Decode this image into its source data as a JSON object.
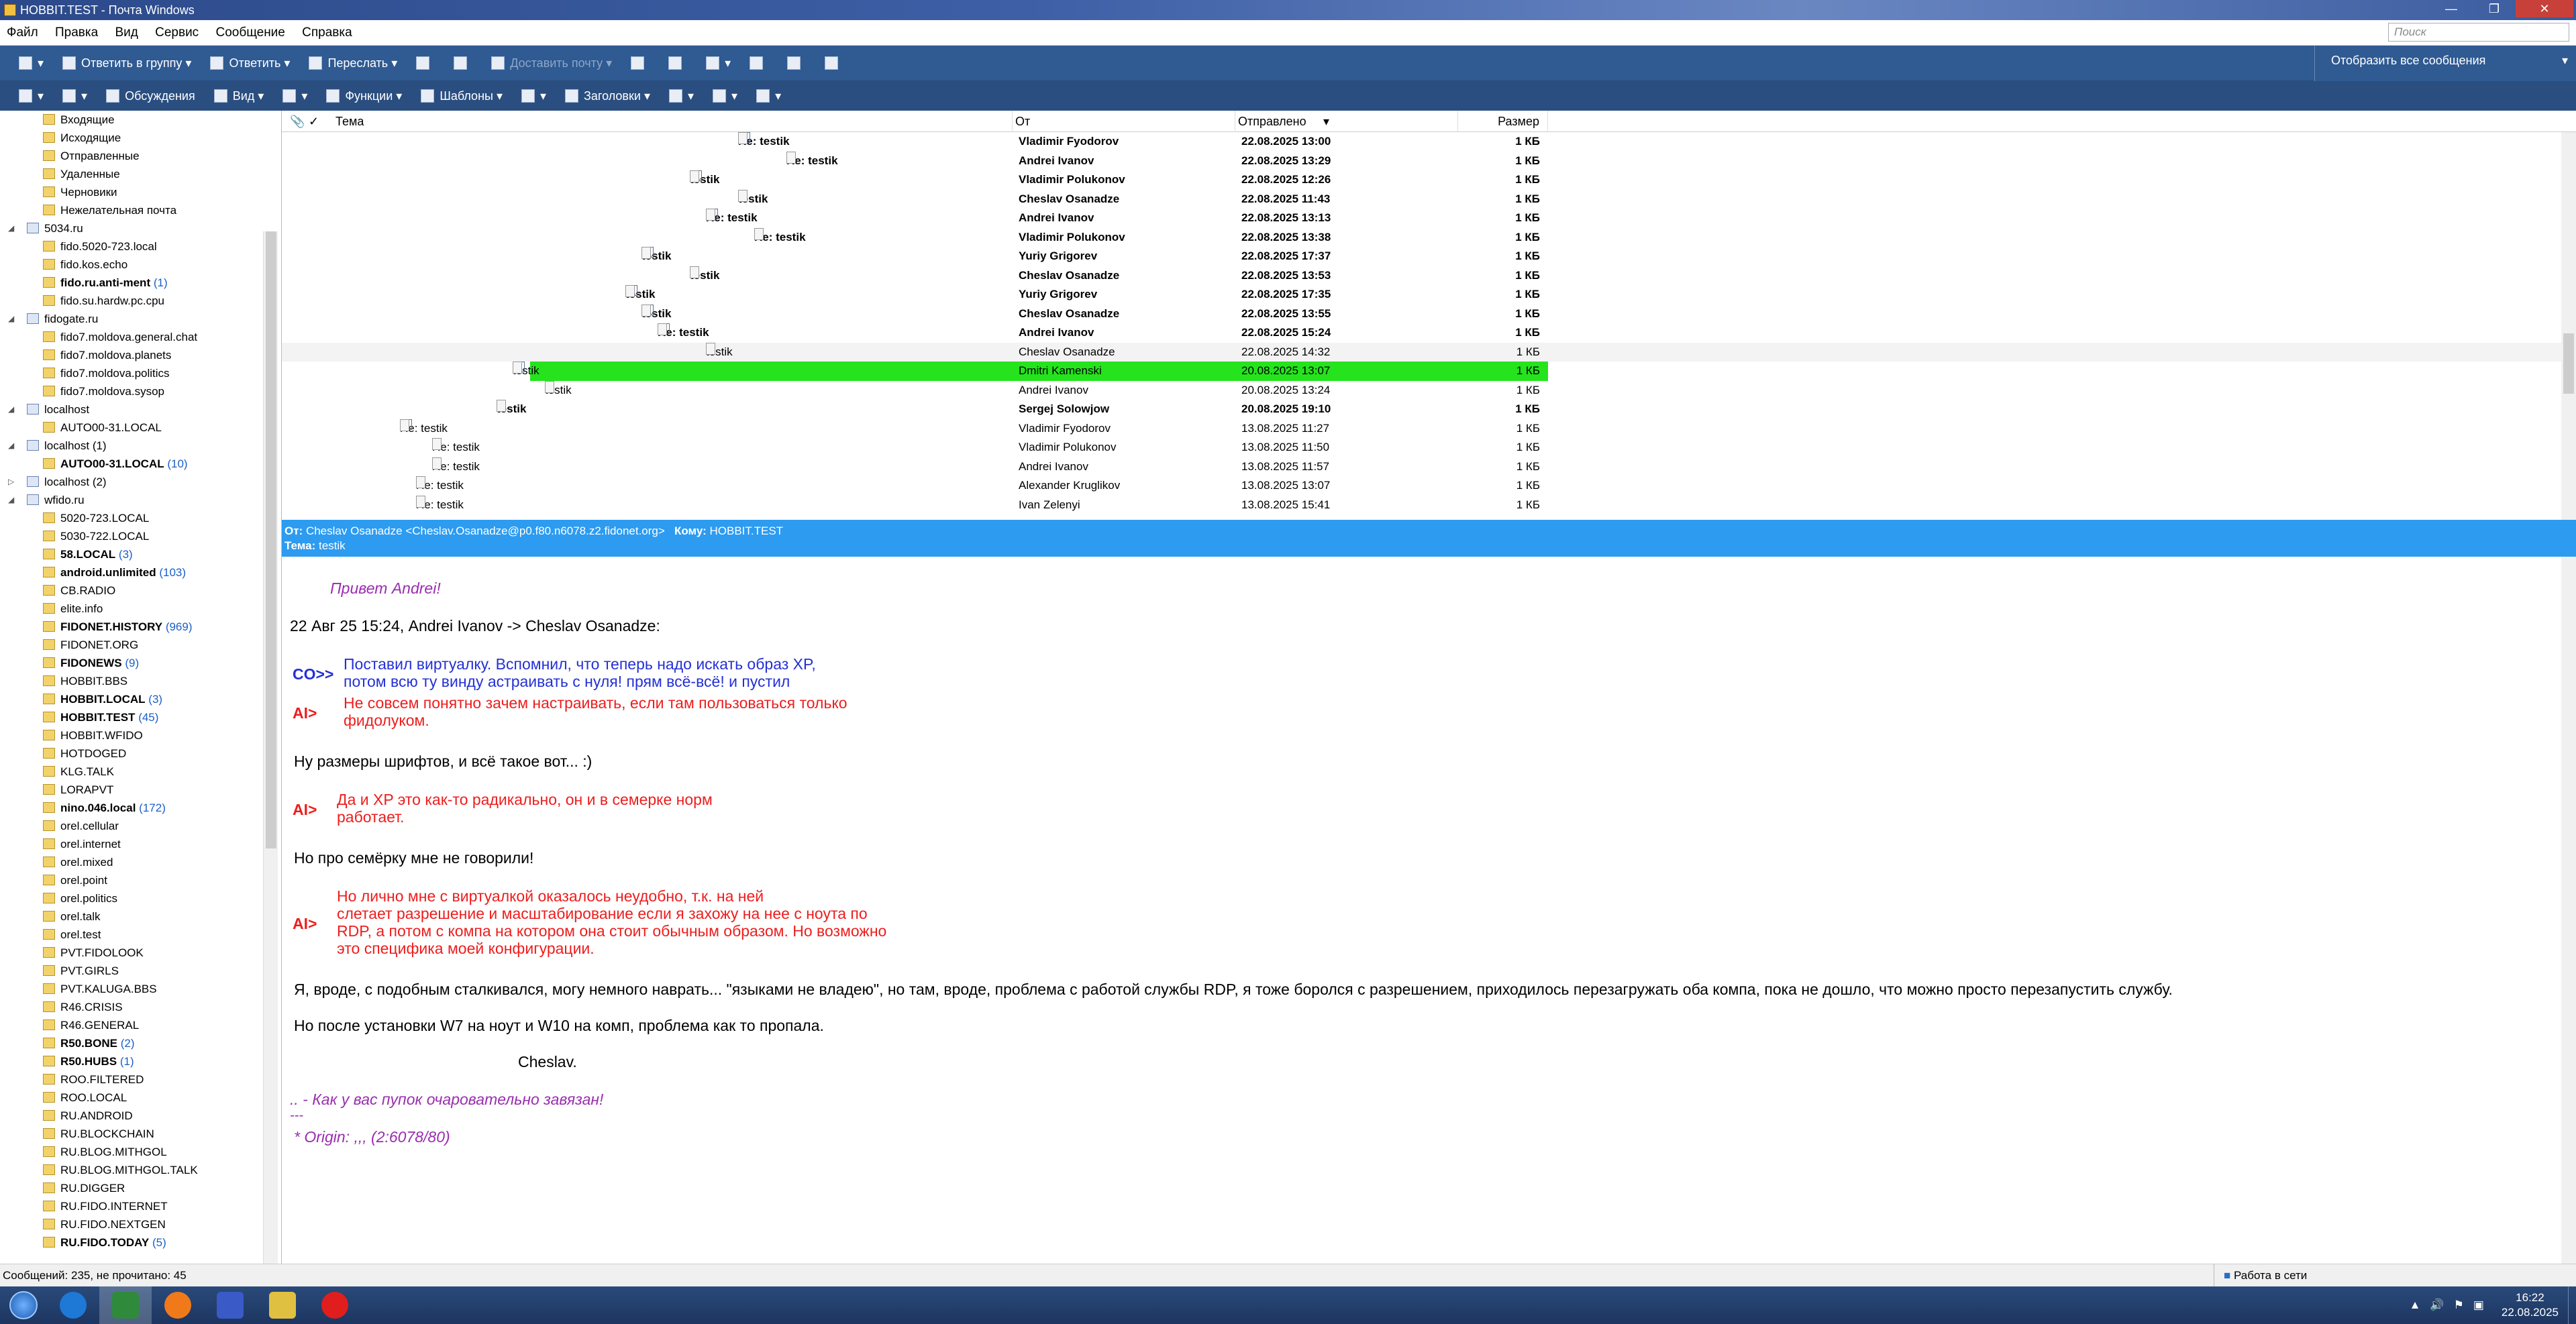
{
  "window": {
    "title": "HOBBIT.TEST - Почта Windows"
  },
  "menu": [
    "Файл",
    "Правка",
    "Вид",
    "Сервис",
    "Сообщение",
    "Справка"
  ],
  "search_placeholder": "Поиск",
  "toolbar1": {
    "reply_group": "Ответить в группу",
    "reply": "Ответить",
    "forward": "Переслать",
    "deliver": "Доставить почту"
  },
  "toolbar2": {
    "discussions": "Обсуждения",
    "view": "Вид",
    "functions": "Функции",
    "templates": "Шаблоны",
    "headers": "Заголовки"
  },
  "filter": "Отобразить все сообщения",
  "folders": [
    {
      "name": "Входящие",
      "level": 2
    },
    {
      "name": "Исходящие",
      "level": 2
    },
    {
      "name": "Отправленные",
      "level": 2
    },
    {
      "name": "Удаленные",
      "level": 2
    },
    {
      "name": "Черновики",
      "level": 2
    },
    {
      "name": "Нежелательная почта",
      "level": 2
    },
    {
      "name": "5034.ru",
      "level": 1,
      "expanded": true
    },
    {
      "name": "fido.5020-723.local",
      "level": 2
    },
    {
      "name": "fido.kos.echo",
      "level": 2
    },
    {
      "name": "fido.ru.anti-ment",
      "count": "(1)",
      "bold": true,
      "level": 2
    },
    {
      "name": "fido.su.hardw.pc.cpu",
      "level": 2
    },
    {
      "name": "fidogate.ru",
      "level": 1,
      "expanded": true
    },
    {
      "name": "fido7.moldova.general.chat",
      "level": 2
    },
    {
      "name": "fido7.moldova.planets",
      "level": 2
    },
    {
      "name": "fido7.moldova.politics",
      "level": 2
    },
    {
      "name": "fido7.moldova.sysop",
      "level": 2
    },
    {
      "name": "localhost",
      "level": 1,
      "expanded": true
    },
    {
      "name": "AUTO00-31.LOCAL",
      "level": 2
    },
    {
      "name": "localhost (1)",
      "level": 1,
      "expanded": true
    },
    {
      "name": "AUTO00-31.LOCAL",
      "count": "(10)",
      "bold": true,
      "level": 2
    },
    {
      "name": "localhost (2)",
      "level": 1,
      "expanded": false
    },
    {
      "name": "wfido.ru",
      "level": 1,
      "expanded": true
    },
    {
      "name": "5020-723.LOCAL",
      "level": 2
    },
    {
      "name": "5030-722.LOCAL",
      "level": 2
    },
    {
      "name": "58.LOCAL",
      "count": "(3)",
      "bold": true,
      "level": 2
    },
    {
      "name": "android.unlimited",
      "count": "(103)",
      "bold": true,
      "level": 2
    },
    {
      "name": "CB.RADIO",
      "level": 2
    },
    {
      "name": "elite.info",
      "level": 2
    },
    {
      "name": "FIDONET.HISTORY",
      "count": "(969)",
      "bold": true,
      "level": 2
    },
    {
      "name": "FIDONET.ORG",
      "level": 2
    },
    {
      "name": "FIDONEWS",
      "count": "(9)",
      "bold": true,
      "level": 2
    },
    {
      "name": "HOBBIT.BBS",
      "level": 2
    },
    {
      "name": "HOBBIT.LOCAL",
      "count": "(3)",
      "bold": true,
      "level": 2
    },
    {
      "name": "HOBBIT.TEST",
      "count": "(45)",
      "bold": true,
      "level": 2
    },
    {
      "name": "HOBBIT.WFIDO",
      "level": 2
    },
    {
      "name": "HOTDOGED",
      "level": 2
    },
    {
      "name": "KLG.TALK",
      "level": 2
    },
    {
      "name": "LORAPVT",
      "level": 2
    },
    {
      "name": "nino.046.local",
      "count": "(172)",
      "bold": true,
      "level": 2
    },
    {
      "name": "orel.cellular",
      "level": 2
    },
    {
      "name": "orel.internet",
      "level": 2
    },
    {
      "name": "orel.mixed",
      "level": 2
    },
    {
      "name": "orel.point",
      "level": 2
    },
    {
      "name": "orel.politics",
      "level": 2
    },
    {
      "name": "orel.talk",
      "level": 2
    },
    {
      "name": "orel.test",
      "level": 2
    },
    {
      "name": "PVT.FIDOLOOK",
      "level": 2
    },
    {
      "name": "PVT.GIRLS",
      "level": 2
    },
    {
      "name": "PVT.KALUGA.BBS",
      "level": 2
    },
    {
      "name": "R46.CRISIS",
      "level": 2
    },
    {
      "name": "R46.GENERAL",
      "level": 2
    },
    {
      "name": "R50.BONE",
      "count": "(2)",
      "bold": true,
      "level": 2
    },
    {
      "name": "R50.HUBS",
      "count": "(1)",
      "bold": true,
      "level": 2
    },
    {
      "name": "ROO.FILTERED",
      "level": 2
    },
    {
      "name": "ROO.LOCAL",
      "level": 2
    },
    {
      "name": "RU.ANDROID",
      "level": 2
    },
    {
      "name": "RU.BLOCKCHAIN",
      "level": 2
    },
    {
      "name": "RU.BLOG.MITHGOL",
      "level": 2
    },
    {
      "name": "RU.BLOG.MITHGOL.TALK",
      "level": 2
    },
    {
      "name": "RU.DIGGER",
      "level": 2
    },
    {
      "name": "RU.FIDO.INTERNET",
      "level": 2
    },
    {
      "name": "RU.FIDO.NEXTGEN",
      "level": 2
    },
    {
      "name": "RU.FIDO.TODAY",
      "count": "(5)",
      "bold": true,
      "level": 2
    }
  ],
  "list": {
    "columns": {
      "subject": "Тема",
      "from": "От",
      "sent": "Отправлено",
      "size": "Размер"
    },
    "rows": [
      {
        "indent": 30,
        "box": true,
        "subject": "Re: testik",
        "from": "Vladimir Fyodorov",
        "date": "22.08.2025 13:00",
        "size": "1 КБ",
        "bold": true
      },
      {
        "indent": 33,
        "box": false,
        "subject": "Re: testik",
        "from": "Andrei Ivanov",
        "date": "22.08.2025 13:29",
        "size": "1 КБ",
        "bold": true
      },
      {
        "indent": 27,
        "box": true,
        "subject": "testik",
        "from": "Vladimir Polukonov",
        "date": "22.08.2025 12:26",
        "size": "1 КБ",
        "bold": true
      },
      {
        "indent": 30,
        "box": false,
        "subject": "testik",
        "from": "Cheslav Osanadze",
        "date": "22.08.2025 11:43",
        "size": "1 КБ",
        "bold": true
      },
      {
        "indent": 28,
        "box": true,
        "subject": "Re: testik",
        "from": "Andrei Ivanov",
        "date": "22.08.2025 13:13",
        "size": "1 КБ",
        "bold": true
      },
      {
        "indent": 31,
        "box": false,
        "subject": "Re: testik",
        "from": "Vladimir Polukonov",
        "date": "22.08.2025 13:38",
        "size": "1 КБ",
        "bold": true
      },
      {
        "indent": 24,
        "box": true,
        "subject": "testik",
        "from": "Yuriy Grigorev",
        "date": "22.08.2025 17:37",
        "size": "1 КБ",
        "bold": true
      },
      {
        "indent": 27,
        "box": false,
        "subject": "testik",
        "from": "Cheslav Osanadze",
        "date": "22.08.2025 13:53",
        "size": "1 КБ",
        "bold": true
      },
      {
        "indent": 23,
        "box": true,
        "subject": "testik",
        "from": "Yuriy Grigorev",
        "date": "22.08.2025 17:35",
        "size": "1 КБ",
        "bold": true
      },
      {
        "indent": 24,
        "box": true,
        "subject": "testik",
        "from": "Cheslav Osanadze",
        "date": "22.08.2025 13:55",
        "size": "1 КБ",
        "bold": true
      },
      {
        "indent": 25,
        "box": true,
        "subject": "Re: testik",
        "from": "Andrei Ivanov",
        "date": "22.08.2025 15:24",
        "size": "1 КБ",
        "bold": true
      },
      {
        "indent": 28,
        "box": false,
        "subject": "testik",
        "from": "Cheslav Osanadze",
        "date": "22.08.2025 14:32",
        "size": "1 КБ",
        "bold": false,
        "current": true
      },
      {
        "indent": 16,
        "box": true,
        "subject": "testik",
        "from": "Dmitri Kamenski",
        "date": "20.08.2025 13:07",
        "size": "1 КБ",
        "bold": false,
        "selected": true
      },
      {
        "indent": 18,
        "box": false,
        "subject": "testik",
        "from": "Andrei Ivanov",
        "date": "20.08.2025 13:24",
        "size": "1 КБ",
        "bold": false
      },
      {
        "indent": 15,
        "box": false,
        "subject": "testik",
        "from": "Sergej Solowjow",
        "date": "20.08.2025 19:10",
        "size": "1 КБ",
        "bold": true
      },
      {
        "indent": 9,
        "box": true,
        "subject": "Re: testik",
        "from": "Vladimir Fyodorov",
        "date": "13.08.2025 11:27",
        "size": "1 КБ",
        "bold": false
      },
      {
        "indent": 11,
        "box": false,
        "subject": "Re: testik",
        "from": "Vladimir Polukonov",
        "date": "13.08.2025 11:50",
        "size": "1 КБ",
        "bold": false
      },
      {
        "indent": 11,
        "box": false,
        "subject": "Re: testik",
        "from": "Andrei Ivanov",
        "date": "13.08.2025 11:57",
        "size": "1 КБ",
        "bold": false
      },
      {
        "indent": 10,
        "box": false,
        "subject": "Re: testik",
        "from": "Alexander Kruglikov",
        "date": "13.08.2025 13:07",
        "size": "1 КБ",
        "bold": false
      },
      {
        "indent": 10,
        "box": false,
        "subject": "Re: testik",
        "from": "Ivan Zelenyi",
        "date": "13.08.2025 15:41",
        "size": "1 КБ",
        "bold": false
      }
    ]
  },
  "header_pane": {
    "from_label": "От:",
    "from": "Cheslav Osanadze <Cheslav.Osanadze@p0.f80.n6078.z2.fidonet.org>",
    "to_label": "Кому:",
    "to": "HOBBIT.TEST",
    "subject_label": "Тема:",
    "subject": "testik"
  },
  "message": {
    "greeting": "Привет Andrei!",
    "intro": "22 Авг 25 15:24, Andrei Ivanov -> Cheslav Osanadze:",
    "q1_prefix": "CO>>",
    "q1_l1": "Поставил виртуалку. Вспомнил, что теперь надо искать образ XP,",
    "q1_l2": "потом всю ту винду астраивать с нуля! прям всё-всё! и пустил",
    "q2_prefix": "AI>",
    "q2_l1": "Не совсем понятно зачем настраивать, если там пользоваться только",
    "q2_l2": "фидолуком.",
    "p1": "Ну размеры шрифтов, и всё такое вот... :)",
    "q3_prefix": "AI>",
    "q3_l1": "Да и XP это как-то радикально, он и в семерке норм",
    "q3_l2": "работает.",
    "p2": "Но про семёрку мне не говорили!",
    "q4_prefix": "AI>",
    "q4_l1": "Но лично мне с виртуалкой оказалось неудобно, т.к. на ней",
    "q4_l2": "слетает разрешение и масштабирование если я захожу на нее с ноута по",
    "q4_l3": "RDP, а потом с компа на котором она стоит обычным образом. Но возможно",
    "q4_l4": "это специфика моей конфигурации.",
    "p3": "Я, вроде, с подобным сталкивался, могу немного наврать... \"языками не владею\", но там, вроде, проблема с работой службы RDP, я тоже боролся с разрешением, приходилось перезагружать оба компа, пока не дошло, что можно просто перезапустить службу.",
    "p4": "Но после установки W7 на ноут и W10 на комп, проблема как то пропала.",
    "sign": "Cheslav.",
    "tagline": ".. - Как у вас пупок очаровательно завязан!",
    "tear": "---",
    "origin": "* Origin: ,,, (2:6078/80)"
  },
  "status": {
    "left": "Сообщений: 235, не прочитано: 45",
    "right": "Работа в сети"
  },
  "tray": {
    "time": "16:22",
    "date": "22.08.2025"
  },
  "colors": {
    "toolbar": "#2f5a92",
    "header_pane": "#2d9bf0",
    "selected": "#25e31c",
    "quote_blue": "#2430d6",
    "quote_red": "#ee1d1d",
    "purple": "#9a2db0"
  }
}
